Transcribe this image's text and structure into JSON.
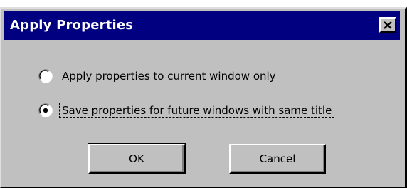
{
  "dialog": {
    "title": "Apply Properties",
    "close_glyph": "×",
    "options": [
      {
        "label": "Apply properties to current window only",
        "selected": false
      },
      {
        "label": "Save properties for future windows with same title",
        "selected": true
      }
    ],
    "ok_label": "OK",
    "cancel_label": "Cancel"
  },
  "colors": {
    "titlebar": "#000080",
    "face": "#c0c0c0",
    "title_text": "#ffffff"
  },
  "icons": {
    "close": "close-icon",
    "radio_unselected": "radio-unchecked-icon",
    "radio_selected": "radio-checked-icon"
  }
}
